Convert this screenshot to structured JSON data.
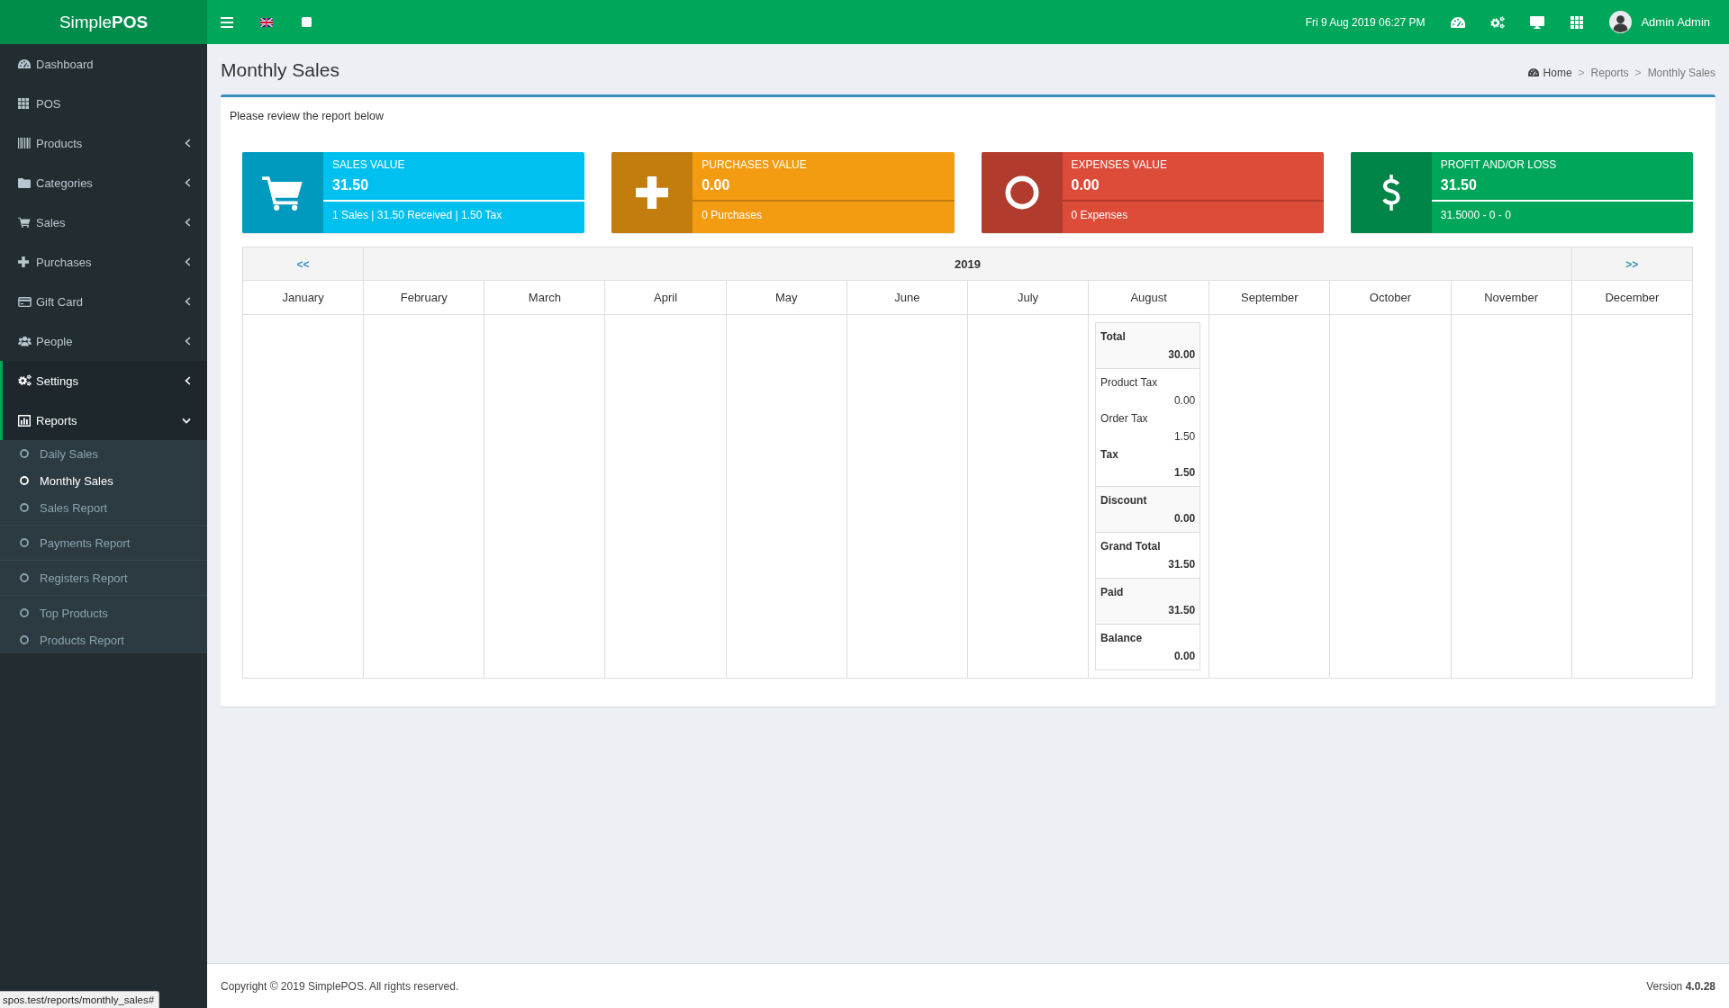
{
  "logo": "Simple**POS**",
  "topbar": {
    "datetime": "Fri 9 Aug 2019 06:27 PM",
    "user": "Admin Admin"
  },
  "sidebar": {
    "items": [
      {
        "label": "Dashboard",
        "kind": "link",
        "selected": false
      },
      {
        "label": "POS",
        "kind": "link",
        "selected": false
      },
      {
        "label": "Products",
        "kind": "menu",
        "selected": false,
        "expanded": false
      },
      {
        "label": "Categories",
        "kind": "menu",
        "selected": false,
        "expanded": false
      },
      {
        "label": "Sales",
        "kind": "menu",
        "selected": false,
        "expanded": false
      },
      {
        "label": "Purchases",
        "kind": "menu",
        "selected": false,
        "expanded": false
      },
      {
        "label": "Gift Card",
        "kind": "menu",
        "selected": false,
        "expanded": false
      },
      {
        "label": "People",
        "kind": "menu",
        "selected": false,
        "expanded": false
      },
      {
        "label": "Settings",
        "kind": "menu",
        "selected": true,
        "expanded": false
      },
      {
        "label": "Reports",
        "kind": "menu",
        "selected": true,
        "expanded": true,
        "groups": [
          [
            {
              "label": "Daily Sales",
              "selected": false
            },
            {
              "label": "Monthly Sales",
              "selected": true
            },
            {
              "label": "Sales Report",
              "selected": false
            }
          ],
          [
            {
              "label": "Payments Report",
              "selected": false
            }
          ],
          [
            {
              "label": "Registers Report",
              "selected": false
            }
          ],
          [
            {
              "label": "Top Products",
              "selected": false
            },
            {
              "label": "Products Report",
              "selected": false
            }
          ]
        ]
      }
    ]
  },
  "header": {
    "title": "Monthly Sales",
    "breadcrumb": [
      {
        "label": "Home",
        "kind": "link"
      },
      {
        "label": "Reports",
        "kind": "text"
      },
      {
        "label": "Monthly Sales",
        "kind": "text"
      }
    ],
    "separators": [
      ">",
      ">"
    ]
  },
  "report": {
    "intro": "Please review the report below",
    "cards": [
      {
        "kind": "sales",
        "title": "SALES VALUE",
        "value": "31.50",
        "level": 1,
        "detail": "1 Sales | 31.50 Received | 1.50 Tax"
      },
      {
        "kind": "purchases",
        "title": "PURCHASES VALUE",
        "value": "0.00",
        "level": 0,
        "detail": "0 Purchases"
      },
      {
        "kind": "expenses",
        "title": "EXPENSES VALUE",
        "value": "0.00",
        "level": 0,
        "detail": "0 Expenses"
      },
      {
        "kind": "profit",
        "title": "PROFIT AND/OR LOSS",
        "value": "31.50",
        "level": 1,
        "detail": "31.5000 - 0 - 0"
      }
    ],
    "calendar": {
      "prev": "<<",
      "year": "2019",
      "next": ">>",
      "months": [
        {
          "name": "January"
        },
        {
          "name": "February"
        },
        {
          "name": "March"
        },
        {
          "name": "April"
        },
        {
          "name": "May"
        },
        {
          "name": "June"
        },
        {
          "name": "July"
        },
        {
          "name": "August",
          "summary": [
            {
              "lines": [
                {
                  "label": "Total",
                  "value": "30.00",
                  "kind": "total"
                }
              ]
            },
            {
              "lines": [
                {
                  "label": "Product Tax",
                  "value": "0.00",
                  "kind": "detail"
                },
                {
                  "label": "Order Tax",
                  "value": "1.50",
                  "kind": "detail"
                },
                {
                  "label": "Tax",
                  "value": "1.50",
                  "kind": "total"
                }
              ]
            },
            {
              "lines": [
                {
                  "label": "Discount",
                  "value": "0.00",
                  "kind": "total"
                }
              ]
            },
            {
              "lines": [
                {
                  "label": "Grand Total",
                  "value": "31.50",
                  "kind": "total"
                }
              ]
            },
            {
              "lines": [
                {
                  "label": "Paid",
                  "value": "31.50",
                  "kind": "total"
                }
              ]
            },
            {
              "lines": [
                {
                  "label": "Balance",
                  "value": "0.00",
                  "kind": "total"
                }
              ]
            }
          ]
        },
        {
          "name": "September"
        },
        {
          "name": "October"
        },
        {
          "name": "November"
        },
        {
          "name": "December"
        }
      ]
    }
  },
  "footer": {
    "copyright": "Copyright © 2019 SimplePOS. All rights reserved.",
    "version": "Version **4.0.28**"
  },
  "status_url": "spos.test/reports/monthly_sales#"
}
